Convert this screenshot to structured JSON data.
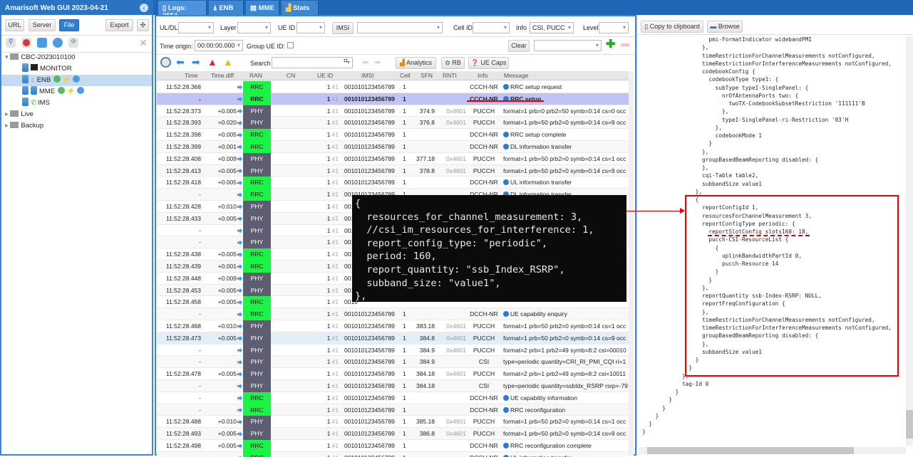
{
  "app": {
    "title": "Amarisoft Web GUI 2023-04-21"
  },
  "tabs": [
    {
      "label": "Logs: 2554"
    },
    {
      "label": "ENB"
    },
    {
      "label": "MME"
    },
    {
      "label": "Stats"
    }
  ],
  "left": {
    "buttons": {
      "url": "URL",
      "server": "Server",
      "file": "File",
      "export": "Export"
    },
    "tree": {
      "root": "CBC-2023010100",
      "items": [
        {
          "label": "MONITOR"
        },
        {
          "label": "ENB"
        },
        {
          "label": "MME"
        },
        {
          "label": "IMS"
        }
      ],
      "live": "Live",
      "backup": "Backup"
    }
  },
  "filters": {
    "uldl": "UL/DL",
    "layer": "Layer",
    "ueid": "UE ID",
    "imsi": "IMSI",
    "cellid": "Cell ID",
    "info": "Info",
    "info_value": "CSI, PUCC",
    "level": "Level",
    "time_origin": "Time origin:",
    "time_origin_value": "00:00:00.000",
    "group_ue": "Group UE ID:",
    "clear": "Clear"
  },
  "toolbar": {
    "search": "Search",
    "analytics": "Analytics",
    "rb": "RB",
    "uecaps": "UE Caps"
  },
  "columns": [
    "Time",
    "Time diff",
    "RAN",
    "CN",
    "UE ID",
    "IMSI",
    "Cell",
    "SFN",
    "RNTI",
    "Info",
    "Message"
  ],
  "rows": [
    [
      "11:52:28.368",
      "",
      "RRC",
      "1",
      "001010123456789",
      "1",
      "",
      "",
      "CCCH-NR",
      "RRC setup request"
    ],
    [
      "-",
      "",
      "RRC",
      "1",
      "001010123456789",
      "1",
      "",
      "",
      "CCCH-NR",
      "RRC setup"
    ],
    [
      "11:52:28.373",
      "+0.005",
      "PHY",
      "1",
      "001010123456789",
      "1",
      "374.9",
      "0x4601",
      "PUCCH",
      "format=1 prb=0 prb2=50 symb=0:14 cs=0 occ"
    ],
    [
      "11:52:28.393",
      "+0.020",
      "PHY",
      "1",
      "001010123456789",
      "1",
      "376.8",
      "0x4601",
      "PUCCH",
      "format=1 prb=50 prb2=0 symb=0:14 cs=9 occ"
    ],
    [
      "11:52:28.398",
      "+0.005",
      "RRC",
      "1",
      "001010123456789",
      "1",
      "",
      "",
      "DCCH-NR",
      "RRC setup complete"
    ],
    [
      "11:52:28.399",
      "+0.001",
      "RRC",
      "1",
      "001010123456789",
      "1",
      "",
      "",
      "DCCH-NR",
      "DL information transfer"
    ],
    [
      "11:52:28.408",
      "+0.009",
      "PHY",
      "1",
      "001010123456789",
      "1",
      "377.18",
      "0x4601",
      "PUCCH",
      "format=1 prb=50 prb2=0 symb=0:14 cs=1 occ"
    ],
    [
      "11:52:28.413",
      "+0.005",
      "PHY",
      "1",
      "001010123456789",
      "1",
      "378.8",
      "0x4601",
      "PUCCH",
      "format=1 prb=50 prb2=0 symb=0:14 cs=9 occ"
    ],
    [
      "11:52:28.418",
      "+0.005",
      "RRC",
      "1",
      "001010123456789",
      "1",
      "",
      "",
      "DCCH-NR",
      "UL information transfer"
    ],
    [
      "-",
      "",
      "RRC",
      "1",
      "001010123456789",
      "1",
      "",
      "",
      "DCCH-NR",
      "DL information transfer"
    ],
    [
      "11:52:28.428",
      "+0.010",
      "PHY",
      "1",
      "0010",
      "",
      "",
      "",
      "",
      ""
    ],
    [
      "11:52:28.433",
      "+0.005",
      "PHY",
      "1",
      "0010",
      "",
      "",
      "",
      "",
      ""
    ],
    [
      "-",
      "",
      "PHY",
      "1",
      "0010",
      "",
      "",
      "",
      "",
      ""
    ],
    [
      "-",
      "",
      "PHY",
      "1",
      "0010",
      "",
      "",
      "",
      "",
      ""
    ],
    [
      "11:52:28.438",
      "+0.005",
      "RRC",
      "1",
      "0010",
      "",
      "",
      "",
      "",
      ""
    ],
    [
      "11:52:28.439",
      "+0.001",
      "RRC",
      "1",
      "0010",
      "",
      "",
      "",
      "",
      ""
    ],
    [
      "11:52:28.448",
      "+0.009",
      "PHY",
      "1",
      "0010",
      "",
      "",
      "",
      "",
      ""
    ],
    [
      "11:52:28.453",
      "+0.005",
      "PHY",
      "1",
      "0010",
      "",
      "",
      "",
      "",
      ""
    ],
    [
      "11:52:28.458",
      "+0.005",
      "RRC",
      "1",
      "0010",
      "",
      "",
      "",
      "",
      ""
    ],
    [
      "-",
      "",
      "RRC",
      "1",
      "001010123456789",
      "1",
      "",
      "",
      "DCCH-NR",
      "UE capability enquiry"
    ],
    [
      "11:52:28.468",
      "+0.010",
      "PHY",
      "1",
      "001010123456789",
      "1",
      "383.18",
      "0x4601",
      "PUCCH",
      "format=1 prb=50 prb2=0 symb=0:14 cs=1 occ"
    ],
    [
      "11:52:28.473",
      "+0.005",
      "PHY",
      "1",
      "001010123456789",
      "1",
      "384.8",
      "0x4601",
      "PUCCH",
      "format=1 prb=50 prb2=0 symb=0:14 cs=9 occ"
    ],
    [
      "-",
      "",
      "PHY",
      "1",
      "001010123456789",
      "1",
      "384.9",
      "0x4601",
      "PUCCH",
      "format=2 prb=1 prb2=49 symb=8:2 csi=00010"
    ],
    [
      "-",
      "",
      "PHY",
      "1",
      "001010123456789",
      "1",
      "384.9",
      "",
      "CSI",
      "type=periodic quantity=CRI_RI_PMI_CQI ri=1"
    ],
    [
      "11:52:28.478",
      "+0.005",
      "PHY",
      "1",
      "001010123456789",
      "1",
      "384.18",
      "0x4601",
      "PUCCH",
      "format=2 prb=1 prb2=49 symb=8:2 csi=10011"
    ],
    [
      "-",
      "",
      "PHY",
      "1",
      "001010123456789",
      "1",
      "384.18",
      "",
      "CSI",
      "type=periodic quantity=ssbIdx_RSRP rsrp=-79"
    ],
    [
      "-",
      "",
      "RRC",
      "1",
      "001010123456789",
      "1",
      "",
      "",
      "DCCH-NR",
      "UE capability information"
    ],
    [
      "-",
      "",
      "RRC",
      "1",
      "001010123456789",
      "1",
      "",
      "",
      "DCCH-NR",
      "RRC reconfiguration"
    ],
    [
      "11:52:28.488",
      "+0.010",
      "PHY",
      "1",
      "001010123456789",
      "1",
      "385.18",
      "0x4601",
      "PUCCH",
      "format=1 prb=50 prb2=0 symb=0:14 cs=1 occ"
    ],
    [
      "11:52:28.493",
      "+0.005",
      "PHY",
      "1",
      "001010123456789",
      "1",
      "386.8",
      "0x4601",
      "PUCCH",
      "format=1 prb=50 prb2=0 symb=0:14 cs=9 occ"
    ],
    [
      "11:52:28.498",
      "+0.005",
      "RRC",
      "1",
      "001010123456789",
      "1",
      "",
      "",
      "DCCH-NR",
      "RRC reconfiguration complete"
    ],
    [
      "-",
      "",
      "RRC",
      "1",
      "001010123456789",
      "1",
      "",
      "",
      "DCCH-NR",
      "UL information transfer"
    ]
  ],
  "ue_sub": "#1",
  "right": {
    "copy": "Copy to clipboard",
    "browse": "Browse",
    "code": "                    pmi-FormatIndicator widebandPMI\n                  },\n                  timeRestrictionForChannelMeasurements notConfigured,\n                  timeRestrictionForInterferenceMeasurements notConfigured,\n                  codebookConfig {\n                    codebookType type1: {\n                      subType typeI-SinglePanel: {\n                        nrOfAntennaPorts two: {\n                          twoTX-CodebookSubsetRestriction '111111'B\n                        },\n                        typeI-SinglePanel-ri-Restriction '03'H\n                      },\n                      codebookMode 1\n                    }\n                  },\n                  groupBasedBeamReporting disabled: {\n                  },\n                  cqi-Table table2,\n                  subbandSize value1\n                },\n                {\n                  reportConfigId 1,\n                  resourcesForChannelMeasurement 3,\n                  reportConfigType periodic: {\n                    reportSlotConfig slots160: 18,\n                    pucch-CSI-ResourceList {\n                      {\n                        uplinkBandwidthPartId 0,\n                        pucch-Resource 14\n                      }\n                    }\n                  },\n                  reportQuantity ssb-Index-RSRP: NULL,\n                  reportFreqConfiguration {\n                  },\n                  timeRestrictionForChannelMeasurements notConfigured,\n                  timeRestrictionForInterferenceMeasurements notConfigured,\n                  groupBasedBeamReporting disabled: {\n                  },\n                  subbandSize value1\n                }\n              }\n            },\n            tag-Id 0\n          }\n        }\n      }\n    }\n  }\n}"
  },
  "overlay": {
    "code": "{\n  resources_for_channel_measurement: 3,\n  //csi_im_resources_for_interference: 1,\n  report_config_type: \"periodic\",\n  period: 160,\n  report_quantity: \"ssb_Index_RSRP\",\n  subband_size: \"value1\",\n},"
  },
  "colors": {
    "accent": "#2b74c4",
    "rrc": "#19f545",
    "phy": "#5e5e72",
    "highlight": "#e00000"
  }
}
